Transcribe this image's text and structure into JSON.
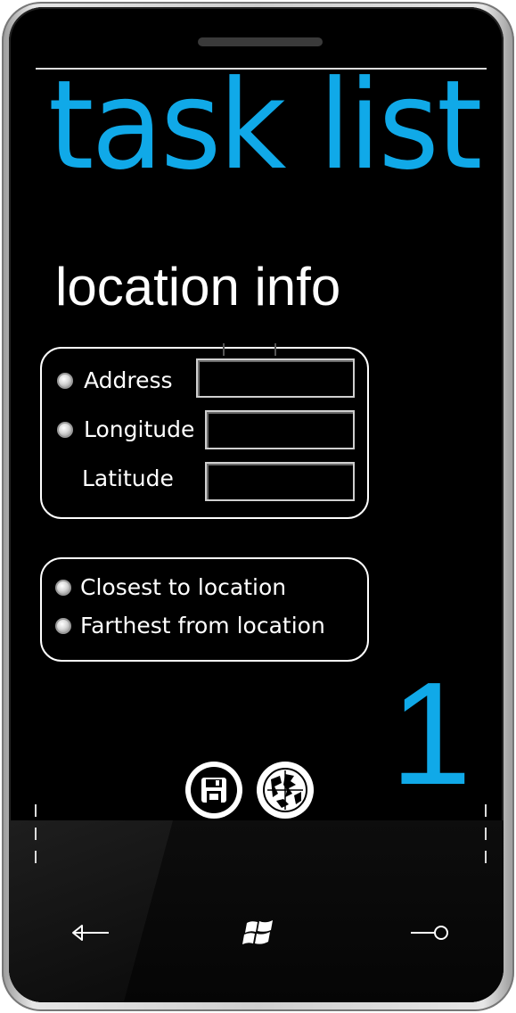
{
  "app": {
    "title": "task list",
    "page_title": "location info",
    "count": "1"
  },
  "location_group": {
    "address_label": "Address",
    "longitude_label": "Longitude",
    "latitude_label": "Latitude",
    "address_value": "",
    "longitude_value": "",
    "latitude_value": ""
  },
  "sort_group": {
    "closest_label": "Closest to location",
    "farthest_label": "Farthest from location"
  },
  "app_bar": {
    "icons": [
      "save-icon",
      "globe-icon"
    ]
  },
  "hardware_buttons": {
    "icons": [
      "back-arrow-icon",
      "windows-logo-icon",
      "search-icon"
    ]
  },
  "colors": {
    "accent": "#10a9e8",
    "background": "#000000",
    "foreground": "#ffffff"
  }
}
